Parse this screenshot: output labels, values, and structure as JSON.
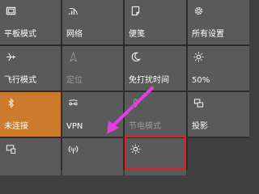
{
  "tiles": [
    {
      "label": "平板模式",
      "icon": "tablet-mode-icon",
      "state": "normal"
    },
    {
      "label": "网络",
      "icon": "network-icon",
      "state": "normal"
    },
    {
      "label": "便笺",
      "icon": "note-icon",
      "state": "normal"
    },
    {
      "label": "所有设置",
      "icon": "gear-icon",
      "state": "normal"
    },
    {
      "label": "飞行模式",
      "icon": "airplane-icon",
      "state": "normal"
    },
    {
      "label": "定位",
      "icon": "location-icon",
      "state": "disabled"
    },
    {
      "label": "免打扰时间",
      "icon": "moon-icon",
      "state": "normal"
    },
    {
      "label": "50%",
      "icon": "brightness-icon",
      "state": "normal"
    },
    {
      "label": "未连接",
      "icon": "bluetooth-icon",
      "state": "on"
    },
    {
      "label": "VPN",
      "icon": "vpn-icon",
      "state": "normal"
    },
    {
      "label": "节电模式",
      "icon": "battery-saver-icon",
      "state": "disabled"
    },
    {
      "label": "投影",
      "icon": "project-icon",
      "state": "normal"
    },
    {
      "label": "",
      "icon": "connect-icon",
      "state": "normal"
    },
    {
      "label": "",
      "icon": "mobile-hotspot-icon",
      "state": "normal"
    },
    {
      "label": "",
      "icon": "night-light-icon",
      "state": "normal"
    },
    {
      "label": "",
      "icon": "",
      "state": "empty"
    }
  ],
  "colors": {
    "tile": "#5a5a5a",
    "tile_on": "#cc7a2b",
    "highlight_box": "#e02020",
    "arrow": "#e040e0"
  }
}
